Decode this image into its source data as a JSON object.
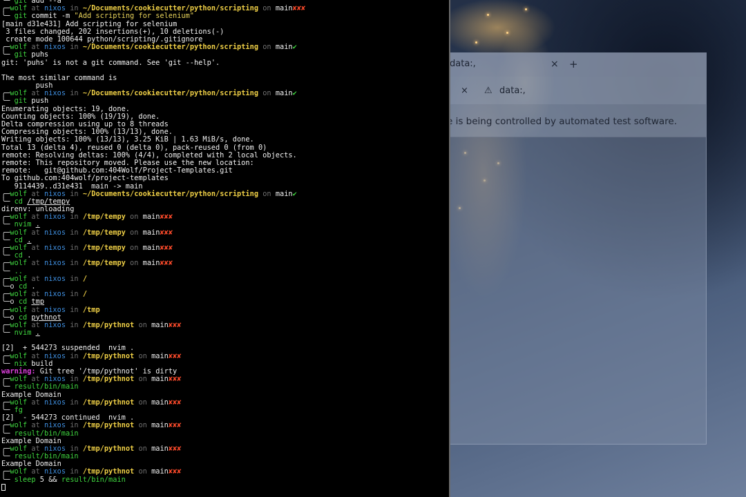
{
  "browser": {
    "tab_title": "data:,",
    "tab_close": "×",
    "new_tab": "+",
    "toolbar_close": "×",
    "warning_icon": "⚠",
    "address": "data:,",
    "infobar": "e is being controlled by automated test software."
  },
  "terminal": {
    "lines": [
      {
        "kind": "cmd",
        "glyph": "╰─ ",
        "cmd": "git",
        "args": " add --a"
      },
      {
        "kind": "prompt",
        "user": "wolf",
        "host": "nixos",
        "path": "~/Documents/cookiecutter/python/scripting",
        "branch": "main",
        "status": "✘✘✘"
      },
      {
        "kind": "cmd",
        "glyph": "╰─ ",
        "cmd": "git",
        "args": " commit -m ",
        "str": "\"Add scripting for selenium\""
      },
      {
        "kind": "out",
        "text": "[main d31e431] Add scripting for selenium"
      },
      {
        "kind": "out",
        "text": " 3 files changed, 202 insertions(+), 10 deletions(-)"
      },
      {
        "kind": "out",
        "text": " create mode 100644 python/scripting/.gitignore"
      },
      {
        "kind": "prompt",
        "user": "wolf",
        "host": "nixos",
        "path": "~/Documents/cookiecutter/python/scripting",
        "branch": "main",
        "status": "✔"
      },
      {
        "kind": "cmd",
        "glyph": "╰─ ",
        "cmd": "git",
        "args": " puhs"
      },
      {
        "kind": "out",
        "text": "git: 'puhs' is not a git command. See 'git --help'."
      },
      {
        "kind": "out",
        "text": ""
      },
      {
        "kind": "out",
        "text": "The most similar command is"
      },
      {
        "kind": "out",
        "text": "        push"
      },
      {
        "kind": "prompt",
        "user": "wolf",
        "host": "nixos",
        "path": "~/Documents/cookiecutter/python/scripting",
        "branch": "main",
        "status": "✔"
      },
      {
        "kind": "cmd",
        "glyph": "╰─ ",
        "cmd": "git",
        "args": " push"
      },
      {
        "kind": "out",
        "text": "Enumerating objects: 19, done."
      },
      {
        "kind": "out",
        "text": "Counting objects: 100% (19/19), done."
      },
      {
        "kind": "out",
        "text": "Delta compression using up to 8 threads"
      },
      {
        "kind": "out",
        "text": "Compressing objects: 100% (13/13), done."
      },
      {
        "kind": "out",
        "text": "Writing objects: 100% (13/13), 3.25 KiB | 1.63 MiB/s, done."
      },
      {
        "kind": "out",
        "text": "Total 13 (delta 4), reused 0 (delta 0), pack-reused 0 (from 0)"
      },
      {
        "kind": "out",
        "text": "remote: Resolving deltas: 100% (4/4), completed with 2 local objects."
      },
      {
        "kind": "out",
        "text": "remote: This repository moved. Please use the new location:"
      },
      {
        "kind": "out",
        "text": "remote:   git@github.com:404Wolf/Project-Templates.git"
      },
      {
        "kind": "out",
        "text": "To github.com:404wolf/project-templates"
      },
      {
        "kind": "out",
        "text": "   9114439..d31e431  main -> main"
      },
      {
        "kind": "prompt",
        "user": "wolf",
        "host": "nixos",
        "path": "~/Documents/cookiecutter/python/scripting",
        "branch": "main",
        "status": "✔"
      },
      {
        "kind": "cmd",
        "glyph": "╰─ ",
        "cmd": "cd",
        "args": " ",
        "uarg": "/tmp/tempy"
      },
      {
        "kind": "out",
        "text": "direnv: unloading"
      },
      {
        "kind": "prompt",
        "user": "wolf",
        "host": "nixos",
        "path": "/tmp/tempy",
        "branch": "main",
        "status": "✘✘✘"
      },
      {
        "kind": "cmd",
        "glyph": "╰─ ",
        "cmd": "nvim",
        "args": " ",
        "uarg": "."
      },
      {
        "kind": "prompt",
        "user": "wolf",
        "host": "nixos",
        "path": "/tmp/tempy",
        "branch": "main",
        "status": "✘✘✘"
      },
      {
        "kind": "cmd",
        "glyph": "╰─ ",
        "cmd": "cd",
        "args": " ",
        "uarg": "."
      },
      {
        "kind": "prompt",
        "user": "wolf",
        "host": "nixos",
        "path": "/tmp/tempy",
        "branch": "main",
        "status": "✘✘✘"
      },
      {
        "kind": "cmd",
        "glyph": "╰─ ",
        "cmd": "cd",
        "args": " ."
      },
      {
        "kind": "prompt",
        "user": "wolf",
        "host": "nixos",
        "path": "/tmp/tempy",
        "branch": "main",
        "status": "✘✘✘"
      },
      {
        "kind": "cmd",
        "glyph": "╰─ ",
        "cmd": "..",
        "args": ""
      },
      {
        "kind": "prompt",
        "user": "wolf",
        "host": "nixos",
        "path": "/",
        "branch": "",
        "status": ""
      },
      {
        "kind": "cmd",
        "glyph": "╰─o ",
        "cmd": "cd",
        "args": " ."
      },
      {
        "kind": "prompt",
        "user": "wolf",
        "host": "nixos",
        "path": "/",
        "branch": "",
        "status": ""
      },
      {
        "kind": "cmd",
        "glyph": "╰─o ",
        "cmd": "cd",
        "args": " ",
        "uarg": "tmp"
      },
      {
        "kind": "prompt",
        "user": "wolf",
        "host": "nixos",
        "path": "/tmp",
        "branch": "",
        "status": ""
      },
      {
        "kind": "cmd",
        "glyph": "╰─o ",
        "cmd": "cd",
        "args": " ",
        "uarg": "pythnot"
      },
      {
        "kind": "prompt",
        "user": "wolf",
        "host": "nixos",
        "path": "/tmp/pythnot",
        "branch": "main",
        "status": "✘✘✘"
      },
      {
        "kind": "cmd",
        "glyph": "╰─ ",
        "cmd": "nvim",
        "args": " ",
        "uarg": "."
      },
      {
        "kind": "out",
        "text": ""
      },
      {
        "kind": "out",
        "text": "[2]  + 544273 suspended  nvim ."
      },
      {
        "kind": "prompt",
        "user": "wolf",
        "host": "nixos",
        "path": "/tmp/pythnot",
        "branch": "main",
        "status": "✘✘✘"
      },
      {
        "kind": "cmd",
        "glyph": "╰─ ",
        "cmd": "nix",
        "args": " build"
      },
      {
        "kind": "warn",
        "label": "warning:",
        "text": " Git tree '/tmp/pythnot' is dirty"
      },
      {
        "kind": "prompt",
        "user": "wolf",
        "host": "nixos",
        "path": "/tmp/pythnot",
        "branch": "main",
        "status": "✘✘✘"
      },
      {
        "kind": "cmd",
        "glyph": "╰─ ",
        "cmd": "result/bin/main",
        "args": ""
      },
      {
        "kind": "out",
        "text": "Example Domain"
      },
      {
        "kind": "prompt",
        "user": "wolf",
        "host": "nixos",
        "path": "/tmp/pythnot",
        "branch": "main",
        "status": "✘✘✘"
      },
      {
        "kind": "cmd",
        "glyph": "╰─ ",
        "cmd": "fg",
        "args": ""
      },
      {
        "kind": "out",
        "text": "[2]  - 544273 continued  nvim ."
      },
      {
        "kind": "prompt",
        "user": "wolf",
        "host": "nixos",
        "path": "/tmp/pythnot",
        "branch": "main",
        "status": "✘✘✘"
      },
      {
        "kind": "cmd",
        "glyph": "╰─ ",
        "cmd": "result/bin/main",
        "args": ""
      },
      {
        "kind": "out",
        "text": "Example Domain"
      },
      {
        "kind": "prompt",
        "user": "wolf",
        "host": "nixos",
        "path": "/tmp/pythnot",
        "branch": "main",
        "status": "✘✘✘"
      },
      {
        "kind": "cmd",
        "glyph": "╰─ ",
        "cmd": "result/bin/main",
        "args": ""
      },
      {
        "kind": "out",
        "text": "Example Domain"
      },
      {
        "kind": "prompt",
        "user": "wolf",
        "host": "nixos",
        "path": "/tmp/pythnot",
        "branch": "main",
        "status": "✘✘✘"
      },
      {
        "kind": "cmd",
        "glyph": "╰─ ",
        "cmd": "sleep",
        "args": " 5 && ",
        "cmd2": "result/bin/main"
      },
      {
        "kind": "cursor"
      }
    ]
  }
}
